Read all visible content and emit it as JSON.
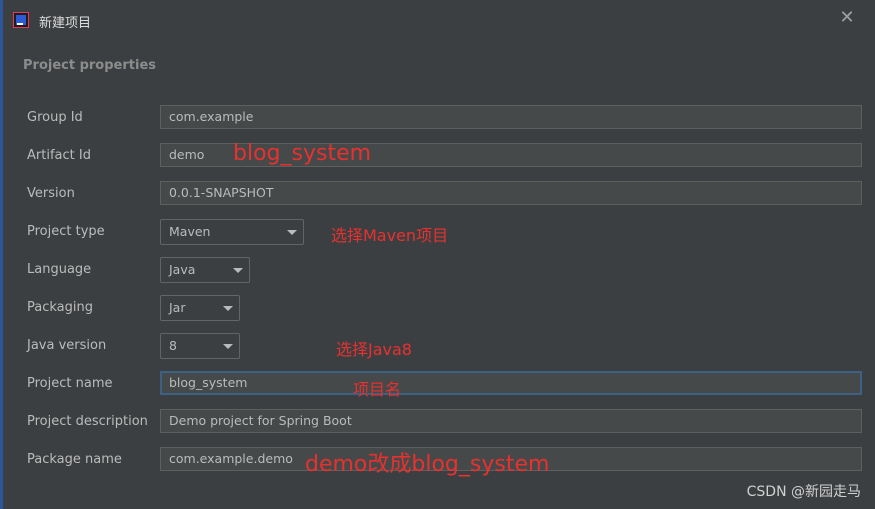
{
  "window": {
    "title": "新建项目",
    "close_icon": "close-icon"
  },
  "section_title": "Project properties",
  "fields": {
    "group_id": {
      "label": "Group Id",
      "value": "com.example"
    },
    "artifact_id": {
      "label": "Artifact Id",
      "value": "demo"
    },
    "version": {
      "label": "Version",
      "value": "0.0.1-SNAPSHOT"
    },
    "project_type": {
      "label": "Project type",
      "value": "Maven"
    },
    "language": {
      "label": "Language",
      "value": "Java"
    },
    "packaging": {
      "label": "Packaging",
      "value": "Jar"
    },
    "java_version": {
      "label": "Java version",
      "value": "8"
    },
    "project_name": {
      "label": "Project name",
      "value": "blog_system"
    },
    "project_description": {
      "label": "Project description",
      "value": "Demo project for Spring Boot"
    },
    "package_name": {
      "label": "Package name",
      "value": "com.example.demo"
    }
  },
  "annotations": {
    "artifact": "blog_system",
    "project_type": "选择Maven项目",
    "java_version": "选择Java8",
    "project_name": "项目名",
    "package_name": "demo改成blog_system"
  },
  "watermark": "CSDN @新园走马",
  "colors": {
    "background": "#3c3f41",
    "field_bg": "#45494a",
    "annotation": "#e8312f",
    "focus_border": "#3d6185"
  }
}
